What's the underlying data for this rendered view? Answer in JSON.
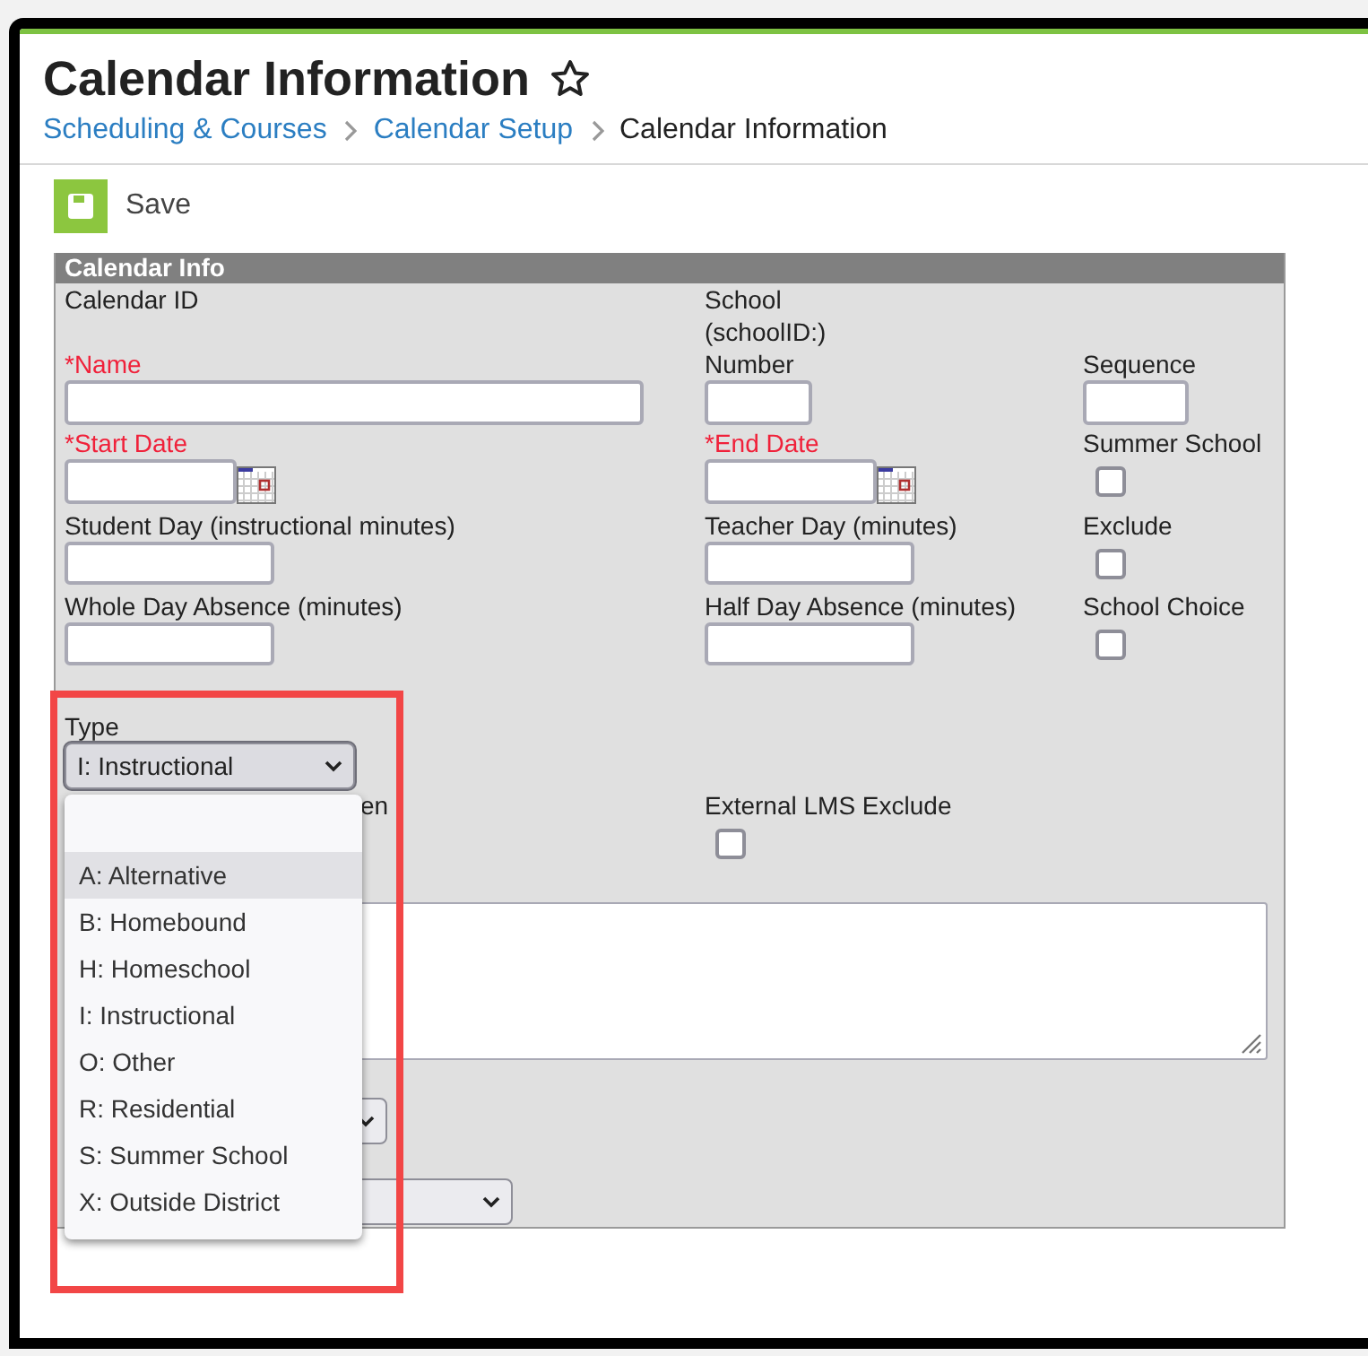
{
  "page": {
    "title": "Calendar Information",
    "favorite": false
  },
  "breadcrumb": [
    {
      "label": "Scheduling & Courses",
      "current": false
    },
    {
      "label": "Calendar Setup",
      "current": false
    },
    {
      "label": "Calendar Information",
      "current": true
    }
  ],
  "toolbar": {
    "save": "Save"
  },
  "panel": {
    "title": "Calendar Info",
    "calendar_id": {
      "label": "Calendar ID"
    },
    "school": {
      "lines": [
        "School",
        "(schoolID:)"
      ]
    },
    "name": {
      "label": "*Name",
      "required": true
    },
    "number": {
      "label": "Number",
      "required": false
    },
    "sequence": {
      "label": "Sequence",
      "required": false
    },
    "start_date": {
      "label": "*Start Date",
      "required": true
    },
    "end_date": {
      "label": "*End Date",
      "required": true
    },
    "summer_school": {
      "label": "Summer School",
      "checked": false
    },
    "student_day": {
      "label": "Student Day (instructional minutes)",
      "required": false
    },
    "teacher_day": {
      "label": "Teacher Day (minutes)",
      "required": false
    },
    "exclude": {
      "label": "Exclude",
      "checked": false
    },
    "whole_day_absence": {
      "label": "Whole Day Absence (minutes)",
      "required": false
    },
    "half_day_absence": {
      "label": "Half Day Absence (minutes)",
      "required": false
    },
    "school_choice": {
      "label": "School Choice",
      "checked": false
    },
    "type": {
      "label": "Type",
      "value": "I: Instructional",
      "expanded": true,
      "options": [
        {
          "label": "A: Alternative",
          "hovered": true
        },
        {
          "label": "B: Homebound",
          "hovered": false
        },
        {
          "label": "H: Homeschool",
          "hovered": false
        },
        {
          "label": "I: Instructional",
          "hovered": false
        },
        {
          "label": "O: Other",
          "hovered": false
        },
        {
          "label": "R: Residential",
          "hovered": false
        },
        {
          "label": "S: Summer School",
          "hovered": false
        },
        {
          "label": "X: Outside District",
          "hovered": false
        }
      ]
    },
    "covered_label": "en",
    "external_lms_exclude": {
      "label": "External LMS Exclude",
      "checked": false
    }
  }
}
